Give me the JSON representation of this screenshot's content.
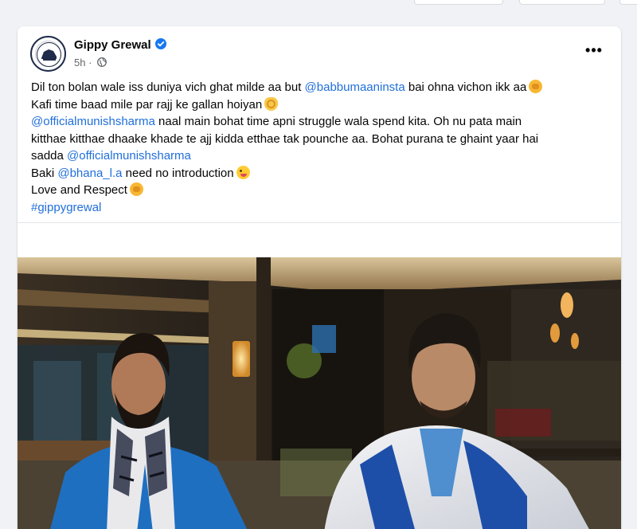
{
  "post": {
    "author": "Gippy Grewal",
    "time": "5h",
    "more_label": "•••",
    "lines": {
      "l1_text": "Dil ton bolan wale iss duniya vich ghat milde aa but ",
      "l1_mention": "@babbumaaninsta",
      "l1_rest": " bai ohna vichon ikk aa",
      "l2_text": "Kafi time baad mile par rajj ke gallan hoiyan",
      "l3_mention": "@officialmunishsharma",
      "l3_rest": " naal main bohat time apni struggle wala spend kita. Oh nu pata main",
      "l4_text": "kitthae kitthae dhaake khade te ajj kidda etthae tak pounche aa. Bohat purana te ghaint yaar hai",
      "l5_text": "sadda ",
      "l5_mention": "@officialmunishsharma",
      "l6_text": "Baki ",
      "l6_mention": "@bhana_l.a",
      "l6_rest": " need no introduction",
      "l7_text": "Love and Respect",
      "hashtag": "#gippygrewal"
    }
  },
  "icons": {
    "verified": "verified-badge-icon",
    "globe": "globe-icon",
    "fist": "fist-emoji-icon",
    "ok_hand": "ok-hand-emoji-icon",
    "wink": "wink-tongue-emoji-icon"
  },
  "colors": {
    "link": "#216fdb",
    "verified": "#1877f2",
    "meta": "#65676b",
    "background": "#f0f2f5"
  }
}
